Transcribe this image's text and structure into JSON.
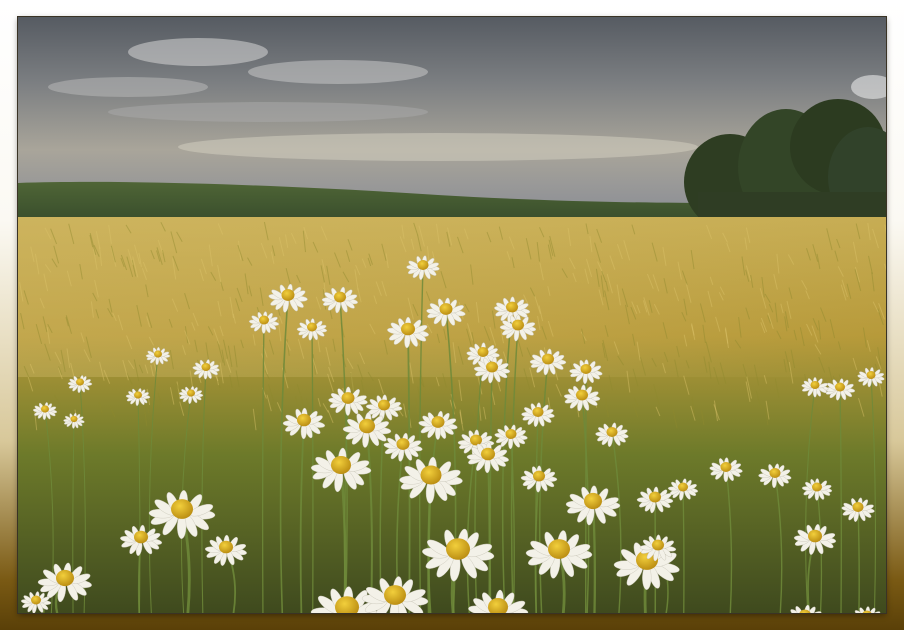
{
  "scene": {
    "subject": "chamomile-field-landscape",
    "colors": {
      "frame_top": "#ffffff",
      "frame_bottom": "#5a4008",
      "sky_top": "#5c6168",
      "sky_horizon": "#b9b4a8",
      "wheat": "#c9b04a",
      "hills": "#3f5a2e",
      "trees": "#2f3f22",
      "petal": "#f4f2ea",
      "flower_center": "#d9a818",
      "stem": "#6f8a3a"
    }
  }
}
